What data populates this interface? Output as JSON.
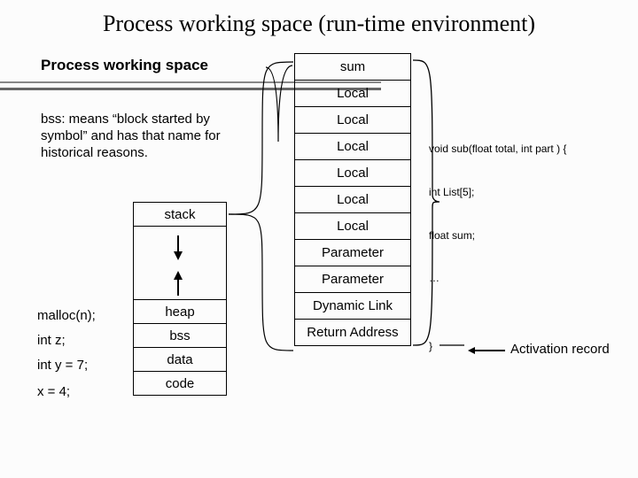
{
  "title": "Process working space (run-time environment)",
  "subheading": "Process working space",
  "bss_note": "bss: means “block started by symbol” and has that name for historical reasons.",
  "mem": {
    "rows": [
      "stack",
      "",
      "heap",
      "bss",
      "data",
      "code"
    ],
    "labels": {
      "heap": "malloc(n);",
      "bss": "int z;",
      "data": "int y = 7;",
      "code": "x = 4;"
    }
  },
  "call_stack": {
    "rows": [
      "sum",
      "Local",
      "Local",
      "Local",
      "Local",
      "Local",
      "Local",
      "Parameter",
      "Parameter",
      "Dynamic Link",
      "Return Address"
    ]
  },
  "code": {
    "l1": "void sub(float total, int part ) {",
    "l2": "int List[5];",
    "l3": "float sum;",
    "l4": "…",
    "l5": "}"
  },
  "activation_label": "Activation record"
}
